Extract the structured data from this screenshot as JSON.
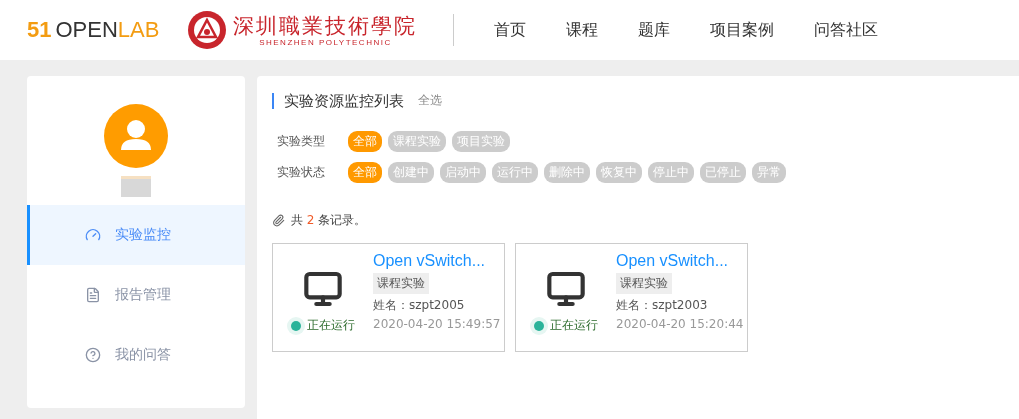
{
  "header": {
    "logo": {
      "digits": "51",
      "word_a": "OPEN",
      "word_b": "LAB"
    },
    "school": {
      "name": "深圳職業技術學院",
      "name_en": "SHENZHEN POLYTECHNIC"
    },
    "nav": [
      {
        "label": "首页",
        "selected": false
      },
      {
        "label": "课程",
        "selected": false
      },
      {
        "label": "题库",
        "selected": false
      },
      {
        "label": "项目案例",
        "selected": false
      },
      {
        "label": "问答社区",
        "selected": false
      }
    ]
  },
  "sidebar": {
    "items": [
      {
        "label": "实验监控",
        "selected": true
      },
      {
        "label": "报告管理",
        "selected": false
      },
      {
        "label": "我的问答",
        "selected": false
      }
    ]
  },
  "main": {
    "title": "实验资源监控列表",
    "select_all": "全选",
    "filters": [
      {
        "label": "实验类型",
        "options": [
          {
            "label": "全部",
            "selected": true
          },
          {
            "label": "课程实验",
            "selected": false
          },
          {
            "label": "项目实验",
            "selected": false
          }
        ]
      },
      {
        "label": "实验状态",
        "options": [
          {
            "label": "全部",
            "selected": true
          },
          {
            "label": "创建中",
            "selected": false
          },
          {
            "label": "启动中",
            "selected": false
          },
          {
            "label": "运行中",
            "selected": false
          },
          {
            "label": "删除中",
            "selected": false
          },
          {
            "label": "恢复中",
            "selected": false
          },
          {
            "label": "停止中",
            "selected": false
          },
          {
            "label": "已停止",
            "selected": false
          },
          {
            "label": "异常",
            "selected": false
          }
        ]
      }
    ],
    "count": {
      "prefix": "共",
      "number": "2",
      "suffix": "条记录。"
    },
    "cards": [
      {
        "title": "Open vSwitch...",
        "tag": "课程实验",
        "status": "正在运行",
        "user": "姓名：szpt2005",
        "time": "2020-04-20 15:49:57"
      },
      {
        "title": "Open vSwitch...",
        "tag": "课程实验",
        "status": "正在运行",
        "user": "姓名：szpt2003",
        "time": "2020-04-20 15:20:44"
      }
    ]
  }
}
